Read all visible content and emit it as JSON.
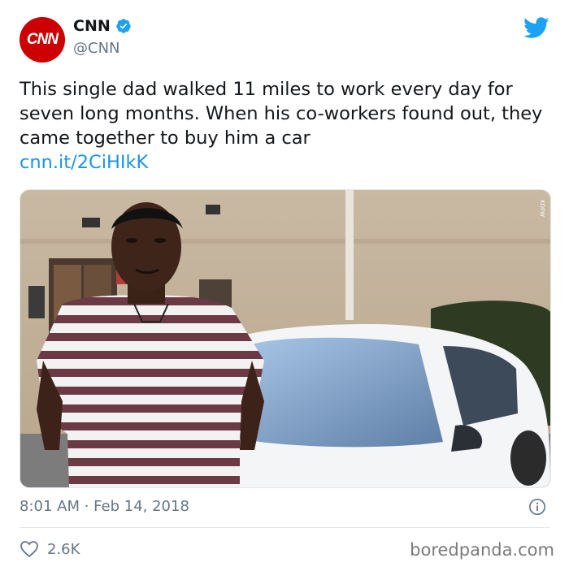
{
  "account": {
    "avatar_text": "CNN",
    "display_name": "CNN",
    "handle": "@CNN",
    "verified_icon": "verified-badge-icon"
  },
  "tweet": {
    "text": "This single dad walked 11 miles to work every day for seven long months. When his co-workers found out, they came together to buy him a car",
    "link": "cnn.it/2CiHIkK",
    "timestamp": "8:01 AM · Feb 14, 2018",
    "likes": "2.6K"
  },
  "media": {
    "alt_icon": "photo-of-man-in-striped-shirt-beside-white-car",
    "badge": "KDFW"
  },
  "watermark": "boredpanda.com",
  "colors": {
    "brand_red": "#cc0000",
    "twitter_blue": "#1da1f2",
    "link_blue": "#1b95e0",
    "muted_text": "#657786"
  }
}
